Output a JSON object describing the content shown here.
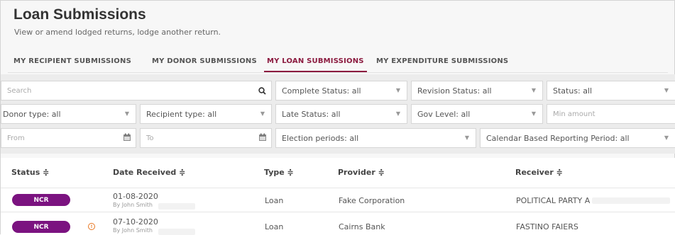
{
  "header": {
    "title": "Loan Submissions",
    "subtitle": "View or amend lodged returns, lodge another return."
  },
  "tabs": [
    {
      "label": "MY RECIPIENT SUBMISSIONS",
      "active": false
    },
    {
      "label": "MY DONOR SUBMISSIONS",
      "active": false
    },
    {
      "label": "MY LOAN SUBMISSIONS",
      "active": true
    },
    {
      "label": "MY EXPENDITURE SUBMISSIONS",
      "active": false
    }
  ],
  "filters": {
    "search_placeholder": "Search",
    "complete_status": "Complete Status: all",
    "revision_status": "Revision Status: all",
    "status": "Status: all",
    "donor_type": "Donor type: all",
    "recipient_type": "Recipient type: all",
    "late_status": "Late Status: all",
    "gov_level": "Gov Level: all",
    "min_amount_placeholder": "Min amount",
    "from_placeholder": "From",
    "to_placeholder": "To",
    "election_periods": "Election periods: all",
    "calendar_period": "Calendar Based Reporting Period: all"
  },
  "table": {
    "headers": {
      "status": "Status ≑",
      "date_received": "Date Received ≑",
      "type": "Type ≑",
      "provider": "Provider ≑",
      "receiver": "Receiver ≑"
    },
    "rows": [
      {
        "status": "NCR",
        "warning": false,
        "date": "01-08-2020",
        "by": "By John Smith",
        "type": "Loan",
        "provider": "Fake Corporation",
        "receiver": "POLITICAL PARTY A"
      },
      {
        "status": "NCR",
        "warning": true,
        "date": "07-10-2020",
        "by": "By John Smith",
        "type": "Loan",
        "provider": "Cairns Bank",
        "receiver": "FASTINO FAIERS"
      }
    ]
  },
  "colors": {
    "accent": "#8b1a3f",
    "badge": "#7b1380",
    "warning": "#e87722"
  }
}
